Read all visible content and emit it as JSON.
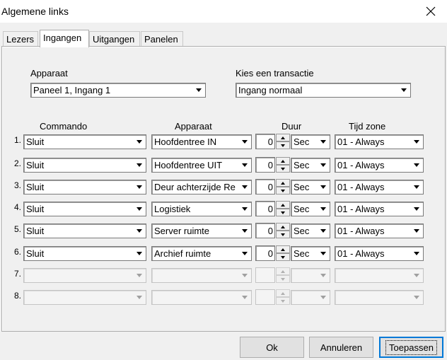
{
  "window": {
    "title": "Algemene links",
    "close_icon": "close-icon"
  },
  "tabs": [
    "Lezers",
    "Ingangen",
    "Uitgangen",
    "Panelen"
  ],
  "active_tab": "Ingangen",
  "top": {
    "apparaat_label": "Apparaat",
    "apparaat_value": "Paneel 1, Ingang 1",
    "transactie_label": "Kies een transactie",
    "transactie_value": "Ingang normaal"
  },
  "columns": {
    "commando": "Commando",
    "apparaat": "Apparaat",
    "duur": "Duur",
    "tijdzone": "Tijd zone"
  },
  "rows": [
    {
      "num": "1.",
      "commando": "Sluit",
      "apparaat": "Hoofdentree IN",
      "duur": "0",
      "unit": "Sec",
      "tijdzone": "01 - Always"
    },
    {
      "num": "2.",
      "commando": "Sluit",
      "apparaat": "Hoofdentree UIT",
      "duur": "0",
      "unit": "Sec",
      "tijdzone": "01 - Always"
    },
    {
      "num": "3.",
      "commando": "Sluit",
      "apparaat": "Deur achterzijde Re",
      "duur": "0",
      "unit": "Sec",
      "tijdzone": "01 - Always"
    },
    {
      "num": "4.",
      "commando": "Sluit",
      "apparaat": "Logistiek",
      "duur": "0",
      "unit": "Sec",
      "tijdzone": "01 - Always"
    },
    {
      "num": "5.",
      "commando": "Sluit",
      "apparaat": "Server ruimte",
      "duur": "0",
      "unit": "Sec",
      "tijdzone": "01 - Always"
    },
    {
      "num": "6.",
      "commando": "Sluit",
      "apparaat": "Archief ruimte",
      "duur": "0",
      "unit": "Sec",
      "tijdzone": "01 - Always"
    },
    {
      "num": "7.",
      "commando": "",
      "apparaat": "",
      "duur": "",
      "unit": "",
      "tijdzone": ""
    },
    {
      "num": "8.",
      "commando": "",
      "apparaat": "",
      "duur": "",
      "unit": "",
      "tijdzone": ""
    }
  ],
  "buttons": {
    "ok": "Ok",
    "annuleren": "Annuleren",
    "toepassen": "Toepassen"
  }
}
